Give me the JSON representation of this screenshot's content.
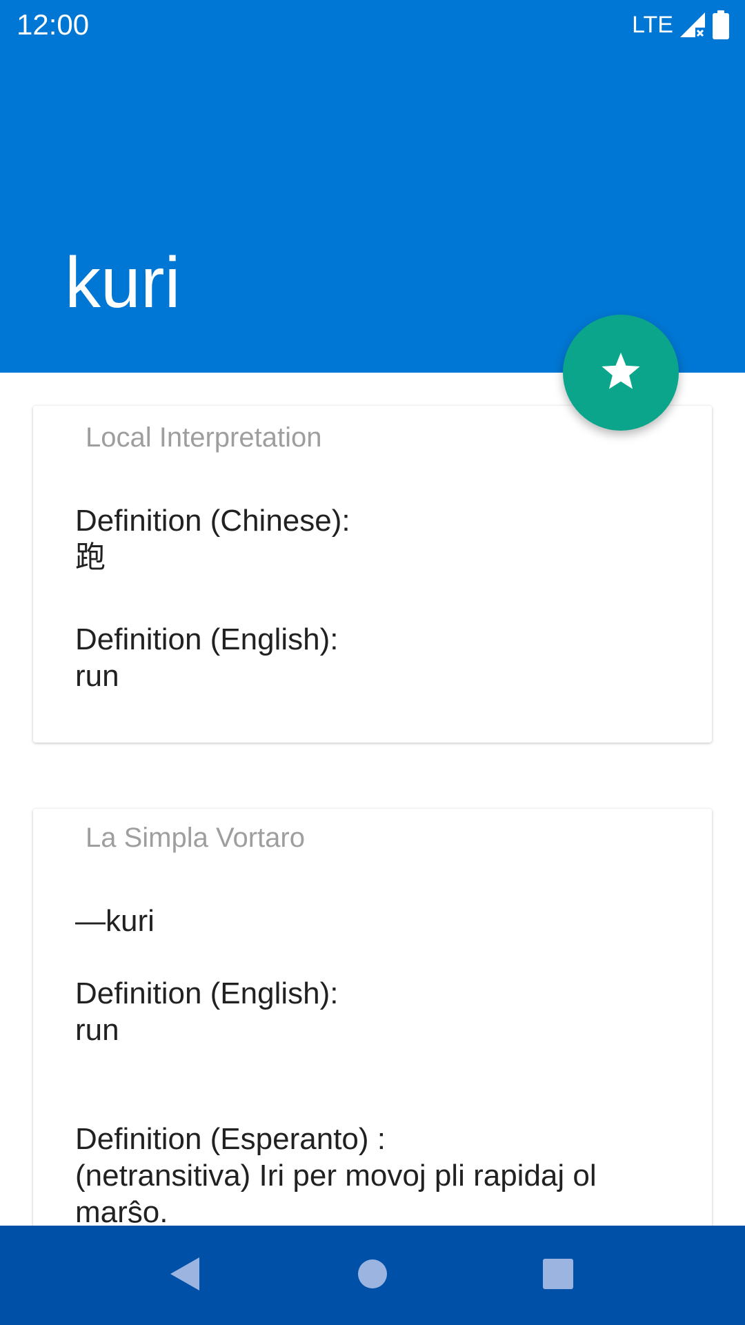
{
  "status_bar": {
    "time": "12:00",
    "network": "LTE",
    "icons": [
      "signal-icon",
      "battery-icon"
    ]
  },
  "header": {
    "title": "kuri"
  },
  "fab": {
    "icon": "star-icon"
  },
  "cards": [
    {
      "title": "Local Interpretation",
      "lines": [
        "Definition (Chinese):",
        "跑",
        "Definition (English):",
        "run"
      ]
    },
    {
      "title": "La Simpla Vortaro",
      "lines": [
        "—kuri",
        "Definition (English):",
        "run",
        "Definition (Esperanto) :",
        "(netransitiva) Iri per movoj pli rapidaj ol marŝo."
      ]
    }
  ],
  "nav_bar": {
    "icons": [
      "back-icon",
      "home-icon",
      "recents-icon"
    ]
  },
  "colors": {
    "app_bar": "#0077d4",
    "fab": "#0aa58a",
    "nav_bar": "#0050a8",
    "card_title": "#9e9e9e",
    "body_text": "#212121"
  }
}
